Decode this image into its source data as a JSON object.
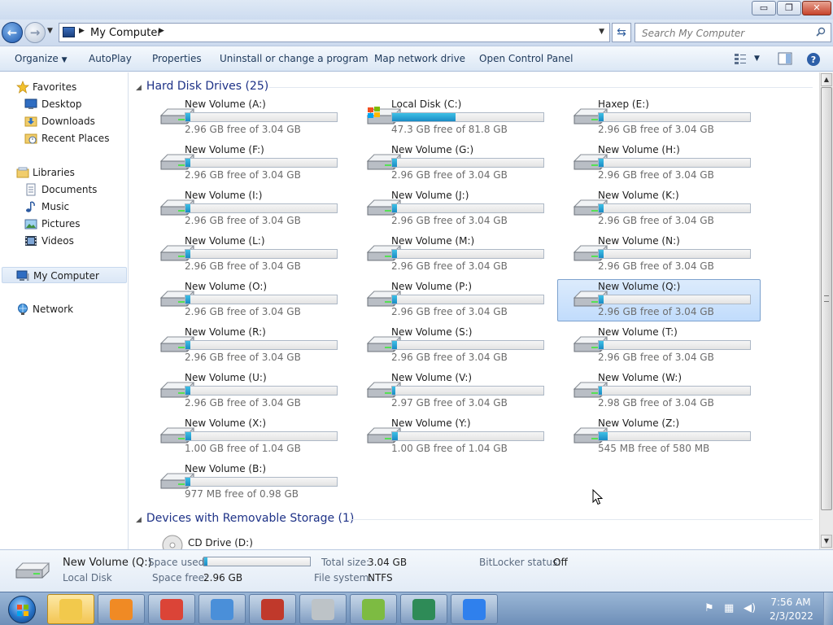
{
  "window": {
    "controls": {
      "minimize": "▭",
      "maximize": "❐",
      "close": "✕"
    }
  },
  "address": {
    "path": "My Computer",
    "search_placeholder": "Search My Computer"
  },
  "toolbar": {
    "organize": "Organize",
    "autoplay": "AutoPlay",
    "properties": "Properties",
    "uninstall": "Uninstall or change a program",
    "map_drive": "Map network drive",
    "control_panel": "Open Control Panel"
  },
  "sidebar": {
    "favorites": "Favorites",
    "desktop": "Desktop",
    "downloads": "Downloads",
    "recent": "Recent Places",
    "libraries": "Libraries",
    "documents": "Documents",
    "music": "Music",
    "pictures": "Pictures",
    "videos": "Videos",
    "computer": "My Computer",
    "network": "Network"
  },
  "groups": {
    "hard_disks": "Hard Disk Drives (25)",
    "removable": "Devices with Removable Storage (1)",
    "partial_device_label": "CD Drive (D:)"
  },
  "drives": [
    {
      "name": "New Volume (A:)",
      "free": "2.96 GB free of 3.04 GB",
      "used": 0.03,
      "icon": "hard-drive"
    },
    {
      "name": "Local Disk (C:)",
      "free": "47.3 GB free of 81.8 GB",
      "used": 0.42,
      "icon": "windows-drive"
    },
    {
      "name": "Haxep (E:)",
      "free": "2.96 GB free of 3.04 GB",
      "used": 0.03,
      "icon": "hard-drive"
    },
    {
      "name": "New Volume (F:)",
      "free": "2.96 GB free of 3.04 GB",
      "used": 0.03,
      "icon": "hard-drive"
    },
    {
      "name": "New Volume (G:)",
      "free": "2.96 GB free of 3.04 GB",
      "used": 0.03,
      "icon": "hard-drive"
    },
    {
      "name": "New Volume (H:)",
      "free": "2.96 GB free of 3.04 GB",
      "used": 0.03,
      "icon": "hard-drive"
    },
    {
      "name": "New Volume (I:)",
      "free": "2.96 GB free of 3.04 GB",
      "used": 0.03,
      "icon": "hard-drive"
    },
    {
      "name": "New Volume (J:)",
      "free": "2.96 GB free of 3.04 GB",
      "used": 0.03,
      "icon": "hard-drive"
    },
    {
      "name": "New Volume (K:)",
      "free": "2.96 GB free of 3.04 GB",
      "used": 0.03,
      "icon": "hard-drive"
    },
    {
      "name": "New Volume (L:)",
      "free": "2.96 GB free of 3.04 GB",
      "used": 0.03,
      "icon": "hard-drive"
    },
    {
      "name": "New Volume (M:)",
      "free": "2.96 GB free of 3.04 GB",
      "used": 0.03,
      "icon": "hard-drive"
    },
    {
      "name": "New Volume (N:)",
      "free": "2.96 GB free of 3.04 GB",
      "used": 0.03,
      "icon": "hard-drive"
    },
    {
      "name": "New Volume (O:)",
      "free": "2.96 GB free of 3.04 GB",
      "used": 0.03,
      "icon": "hard-drive"
    },
    {
      "name": "New Volume (P:)",
      "free": "2.96 GB free of 3.04 GB",
      "used": 0.03,
      "icon": "hard-drive"
    },
    {
      "name": "New Volume (Q:)",
      "free": "2.96 GB free of 3.04 GB",
      "used": 0.03,
      "icon": "hard-drive",
      "selected": true
    },
    {
      "name": "New Volume (R:)",
      "free": "2.96 GB free of 3.04 GB",
      "used": 0.03,
      "icon": "hard-drive"
    },
    {
      "name": "New Volume (S:)",
      "free": "2.96 GB free of 3.04 GB",
      "used": 0.03,
      "icon": "hard-drive"
    },
    {
      "name": "New Volume (T:)",
      "free": "2.96 GB free of 3.04 GB",
      "used": 0.03,
      "icon": "hard-drive"
    },
    {
      "name": "New Volume (U:)",
      "free": "2.96 GB free of 3.04 GB",
      "used": 0.03,
      "icon": "hard-drive"
    },
    {
      "name": "New Volume (V:)",
      "free": "2.97 GB free of 3.04 GB",
      "used": 0.02,
      "icon": "hard-drive"
    },
    {
      "name": "New Volume (W:)",
      "free": "2.98 GB free of 3.04 GB",
      "used": 0.02,
      "icon": "hard-drive"
    },
    {
      "name": "New Volume (X:)",
      "free": "1.00 GB free of 1.04 GB",
      "used": 0.04,
      "icon": "hard-drive"
    },
    {
      "name": "New Volume (Y:)",
      "free": "1.00 GB free of 1.04 GB",
      "used": 0.04,
      "icon": "hard-drive"
    },
    {
      "name": "New Volume (Z:)",
      "free": "545 MB free of 580 MB",
      "used": 0.06,
      "icon": "hard-drive"
    },
    {
      "name": "New Volume (B:)",
      "free": "977 MB free of 0.98 GB",
      "used": 0.03,
      "icon": "hard-drive"
    }
  ],
  "details": {
    "name": "New Volume (Q:)",
    "type": "Local Disk",
    "space_used_label": "Space used:",
    "space_used_fraction": 0.03,
    "space_free_label": "Space free:",
    "space_free": "2.96 GB",
    "total_size_label": "Total size:",
    "total_size": "3.04 GB",
    "file_system_label": "File system:",
    "file_system": "NTFS",
    "bitlocker_label": "BitLocker status:",
    "bitlocker": "Off"
  },
  "taskbar": {
    "time": "7:56 AM",
    "date": "2/3/2022",
    "apps": [
      {
        "icon": "explorer-icon",
        "color": "#f2c94c",
        "active": true
      },
      {
        "icon": "media-player-icon",
        "color": "#f08a24"
      },
      {
        "icon": "chrome-icon",
        "color": "#db4437"
      },
      {
        "icon": "control-panel-icon",
        "color": "#4a8fd9"
      },
      {
        "icon": "toolbox-icon",
        "color": "#c0392b"
      },
      {
        "icon": "disk-utility-icon",
        "color": "#bdc3c7"
      },
      {
        "icon": "notepad-icon",
        "color": "#7dbb42"
      },
      {
        "icon": "network-tool-icon",
        "color": "#2e8b57"
      },
      {
        "icon": "remote-app-icon",
        "color": "#2f80ed"
      }
    ]
  },
  "colors": {
    "accent": "#1e3287",
    "bar_fill": "#26a3d8",
    "selection": "#c1dcfc"
  }
}
